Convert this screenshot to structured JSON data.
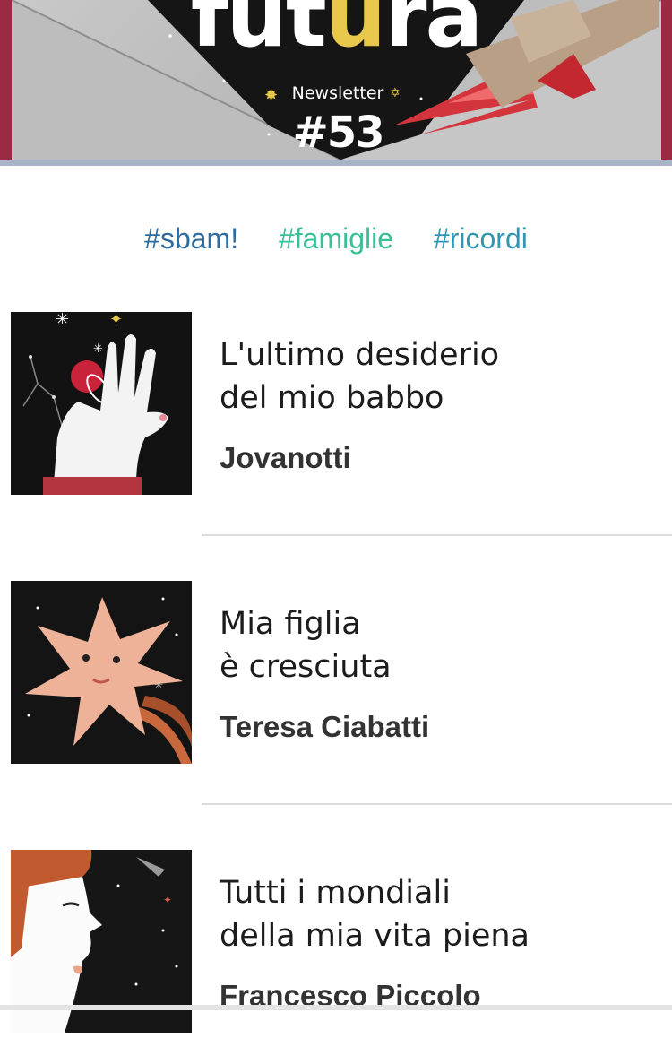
{
  "header": {
    "logo_prefix": "fut",
    "logo_highlight": "u",
    "logo_suffix": "ra",
    "newsletter_label": "Newsletter",
    "issue_number": "#53"
  },
  "tags": [
    "#sbam!",
    "#famiglie",
    "#ricordi"
  ],
  "articles": [
    {
      "title_line1": "L'ultimo desiderio",
      "title_line2": "del mio babbo",
      "author": "Jovanotti"
    },
    {
      "title_line1": "Mia figlia",
      "title_line2": "è cresciuta",
      "author": "Teresa Ciabatti"
    },
    {
      "title_line1": "Tutti i mondiali",
      "title_line2": "della mia vita piena",
      "author": "Francesco Piccolo"
    }
  ],
  "colors": {
    "banner_edge": "#9a2b43",
    "logo_accent": "#e8c84a",
    "tag_sbam": "#2e6c9f",
    "tag_famiglie": "#3cbf99",
    "tag_ricordi": "#2f97b2",
    "author_text": "#333333"
  }
}
